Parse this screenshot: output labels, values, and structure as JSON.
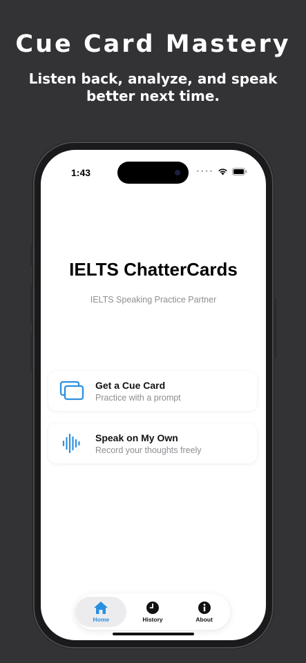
{
  "promo": {
    "title": "Cue Card Mastery",
    "subtitle": "Listen back, analyze, and speak better next time."
  },
  "status_bar": {
    "time": "1:43"
  },
  "app": {
    "title": "IELTS ChatterCards",
    "subtitle": "IELTS Speaking Practice Partner"
  },
  "cards": [
    {
      "title": "Get a Cue Card",
      "subtitle": "Practice with a prompt",
      "icon": "cards-icon"
    },
    {
      "title": "Speak on My Own",
      "subtitle": "Record your thoughts freely",
      "icon": "waveform-icon"
    }
  ],
  "tabs": [
    {
      "label": "Home",
      "icon": "house-icon",
      "active": true
    },
    {
      "label": "History",
      "icon": "clock-icon",
      "active": false
    },
    {
      "label": "About",
      "icon": "info-icon",
      "active": false
    }
  ],
  "colors": {
    "accent": "#2b8fe0",
    "background": "#333335",
    "text_secondary": "#8e8e93"
  }
}
